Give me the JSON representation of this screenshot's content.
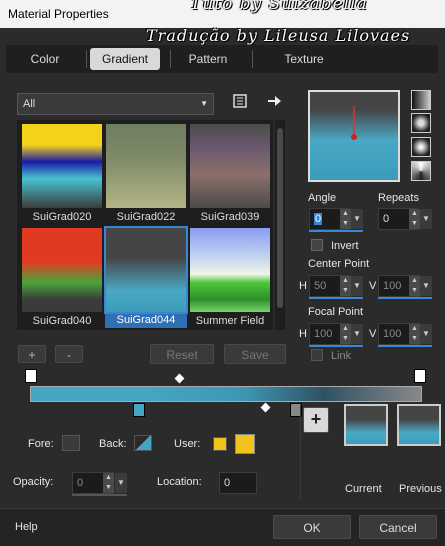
{
  "window": {
    "title": "Material Properties"
  },
  "watermark": {
    "line1": "Tuto by Suizabella",
    "line2": "Tradução by Lileusa Lilovaes"
  },
  "tabs": [
    {
      "label": "Color",
      "active": false
    },
    {
      "label": "Gradient",
      "active": true
    },
    {
      "label": "Pattern",
      "active": false
    },
    {
      "label": "Texture",
      "active": false
    }
  ],
  "category": {
    "value": "All"
  },
  "gradients": [
    {
      "name": "SuiGrad020",
      "selected": false
    },
    {
      "name": "SuiGrad022",
      "selected": false
    },
    {
      "name": "SuiGrad039",
      "selected": false
    },
    {
      "name": "SuiGrad040",
      "selected": false
    },
    {
      "name": "SuiGrad044",
      "selected": true
    },
    {
      "name": "Summer Field",
      "selected": false
    }
  ],
  "buttons": {
    "add": "+",
    "remove": "-",
    "reset": "Reset",
    "save": "Save"
  },
  "angle": {
    "label": "Angle",
    "value": "0"
  },
  "repeats": {
    "label": "Repeats",
    "value": "0"
  },
  "invert": {
    "label": "Invert",
    "checked": false
  },
  "center_point": {
    "label": "Center Point",
    "h_label": "H",
    "h": "50",
    "v_label": "V",
    "v": "100"
  },
  "focal_point": {
    "label": "Focal Point",
    "h_label": "H",
    "h": "100",
    "v_label": "V",
    "v": "100"
  },
  "link": {
    "label": "Link",
    "checked": false
  },
  "fore": {
    "label": "Fore:"
  },
  "back": {
    "label": "Back:"
  },
  "user": {
    "label": "User:"
  },
  "opacity": {
    "label": "Opacity:",
    "value": "0"
  },
  "location": {
    "label": "Location:",
    "value": "0"
  },
  "preview": {
    "current": "Current",
    "previous": "Previous"
  },
  "footer": {
    "help": "Help",
    "ok": "OK",
    "cancel": "Cancel"
  },
  "colors": {
    "accent": "#3b86d4",
    "user_color": "#f2c31a",
    "gradient_blue": "#45a6c4"
  }
}
